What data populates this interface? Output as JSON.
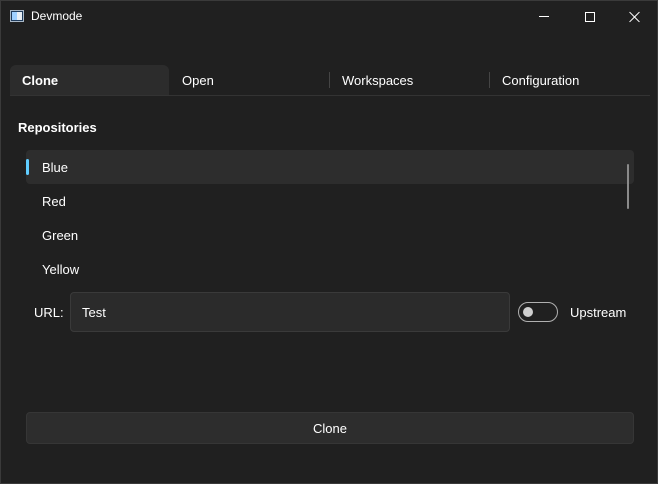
{
  "window": {
    "title": "Devmode",
    "app_icon": "app-window-icon",
    "controls": {
      "minimize_icon": "minimize-icon",
      "maximize_icon": "maximize-icon",
      "close_icon": "close-icon"
    }
  },
  "tabs": [
    {
      "label": "Clone",
      "active": true
    },
    {
      "label": "Open",
      "active": false
    },
    {
      "label": "Workspaces",
      "active": false
    },
    {
      "label": "Configuration",
      "active": false
    }
  ],
  "repositories": {
    "label": "Repositories",
    "items": [
      {
        "label": "Blue",
        "selected": true
      },
      {
        "label": "Red",
        "selected": false
      },
      {
        "label": "Green",
        "selected": false
      },
      {
        "label": "Yellow",
        "selected": false
      }
    ]
  },
  "url": {
    "label": "URL:",
    "value": "Test"
  },
  "upstream": {
    "label": "Upstream",
    "enabled": false
  },
  "actions": {
    "clone_label": "Clone"
  },
  "colors": {
    "background": "#202020",
    "accent": "#60cdff",
    "surface": "#2d2d2d"
  }
}
